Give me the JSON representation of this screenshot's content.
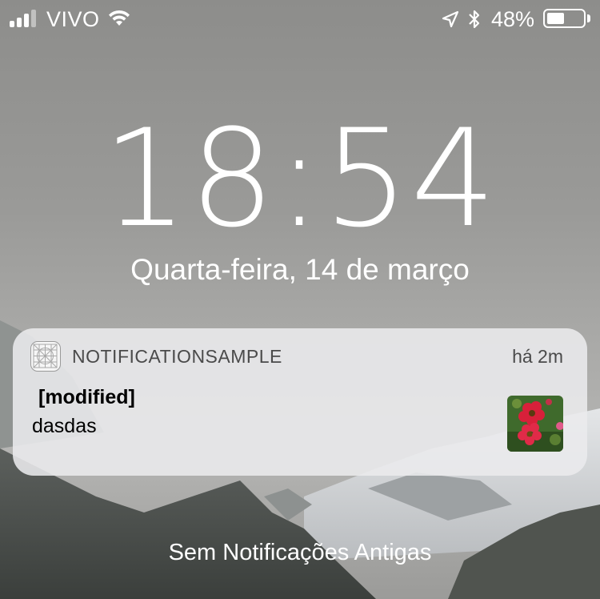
{
  "status_bar": {
    "carrier": "VIVO",
    "battery_percent": "48%",
    "battery_level": 0.48,
    "signal_icon": "signal-bars-icon",
    "wifi_icon": "wifi-icon",
    "location_icon": "location-arrow-icon",
    "bluetooth_icon": "bluetooth-icon"
  },
  "lock_screen": {
    "time": "18:54",
    "date": "Quarta-feira, 14 de março"
  },
  "notification": {
    "app_name": "NOTIFICATIONSAMPLE",
    "timestamp": "há 2m",
    "title": "[modified]",
    "body": "dasdas",
    "app_icon": "app-placeholder-icon",
    "thumbnail": "flower-photo"
  },
  "footer": {
    "label": "Sem Notificações Antigas"
  }
}
